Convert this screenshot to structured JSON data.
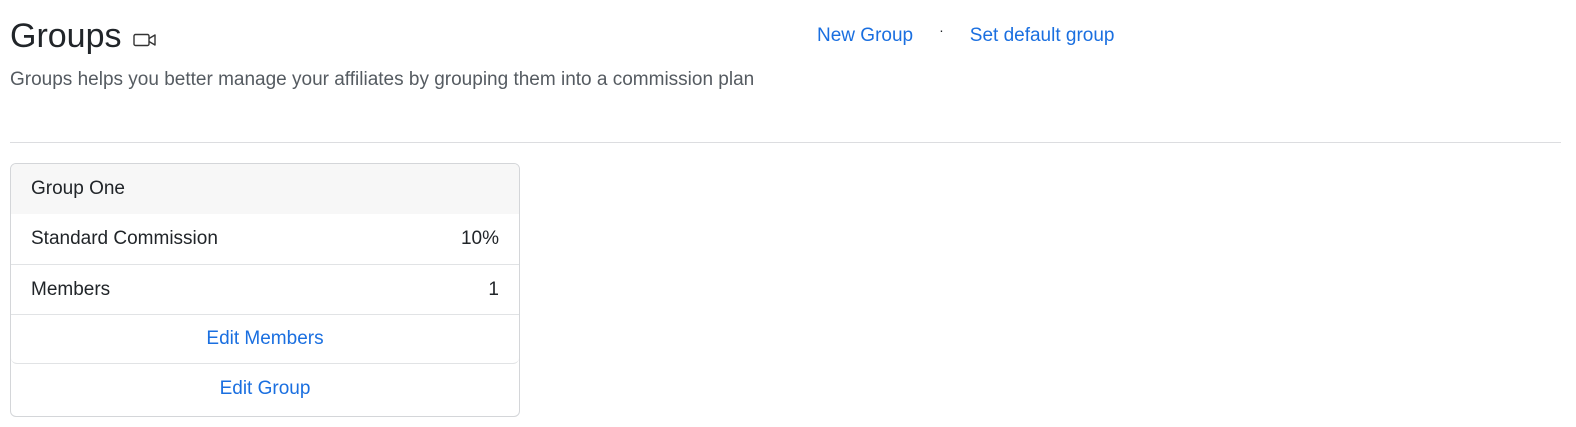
{
  "header": {
    "title": "Groups",
    "subtitle": "Groups helps you better manage your affiliates by grouping them into a commission plan",
    "video_icon": "video-camera-icon"
  },
  "actions": {
    "new_group": "New Group",
    "separator": "·",
    "set_default_group": "Set default group"
  },
  "group_card": {
    "name": "Group One",
    "rows": [
      {
        "label": "Standard Commission",
        "value": "10%"
      },
      {
        "label": "Members",
        "value": "1"
      }
    ],
    "edit_members": "Edit Members",
    "edit_group": "Edit Group"
  },
  "colors": {
    "link": "#1a6fe0",
    "text": "#212529",
    "muted": "#555b61",
    "card_header_bg": "#f7f7f7"
  }
}
